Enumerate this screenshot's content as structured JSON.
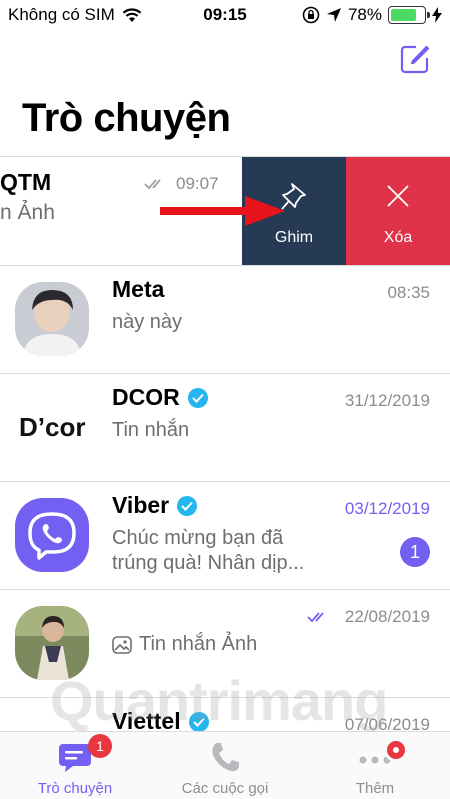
{
  "status_bar": {
    "carrier": "Không có SIM",
    "time": "09:15",
    "battery": "78%",
    "battery_level": 0.78
  },
  "header": {
    "title": "Trò chuyện",
    "compose_icon": "compose-icon"
  },
  "swiped_chat": {
    "name": "QTM",
    "preview": "n Ảnh",
    "time": "09:07",
    "actions": {
      "pin_label": "Ghim",
      "delete_label": "Xóa"
    }
  },
  "chats": [
    {
      "name": "Meta",
      "preview": "này này",
      "time": "08:35"
    },
    {
      "name": "DCOR",
      "preview": "Tin nhắn",
      "time": "31/12/2019",
      "logo_text": "D’cor"
    },
    {
      "name": "Viber",
      "preview_line1": "Chúc mừng bạn đã",
      "preview_line2": "trúng quà! Nhân dịp...",
      "time": "03/12/2019",
      "unread": "1"
    },
    {
      "name": "",
      "preview": "Tin nhắn Ảnh",
      "time": "22/08/2019"
    },
    {
      "name": "Viettel",
      "time": "07/06/2019"
    }
  ],
  "tab_bar": {
    "tabs": [
      {
        "label": "Trò chuyện",
        "badge": "1"
      },
      {
        "label": "Các cuộc gọi"
      },
      {
        "label": "Thêm"
      }
    ]
  },
  "watermark": "Quantrimang",
  "colors": {
    "accent": "#7360f2",
    "pin_bg": "#263a55",
    "delete_bg": "#e0334a",
    "badge": "#e8373f",
    "verified": "#25b6f0",
    "arrow": "#e8141c"
  }
}
